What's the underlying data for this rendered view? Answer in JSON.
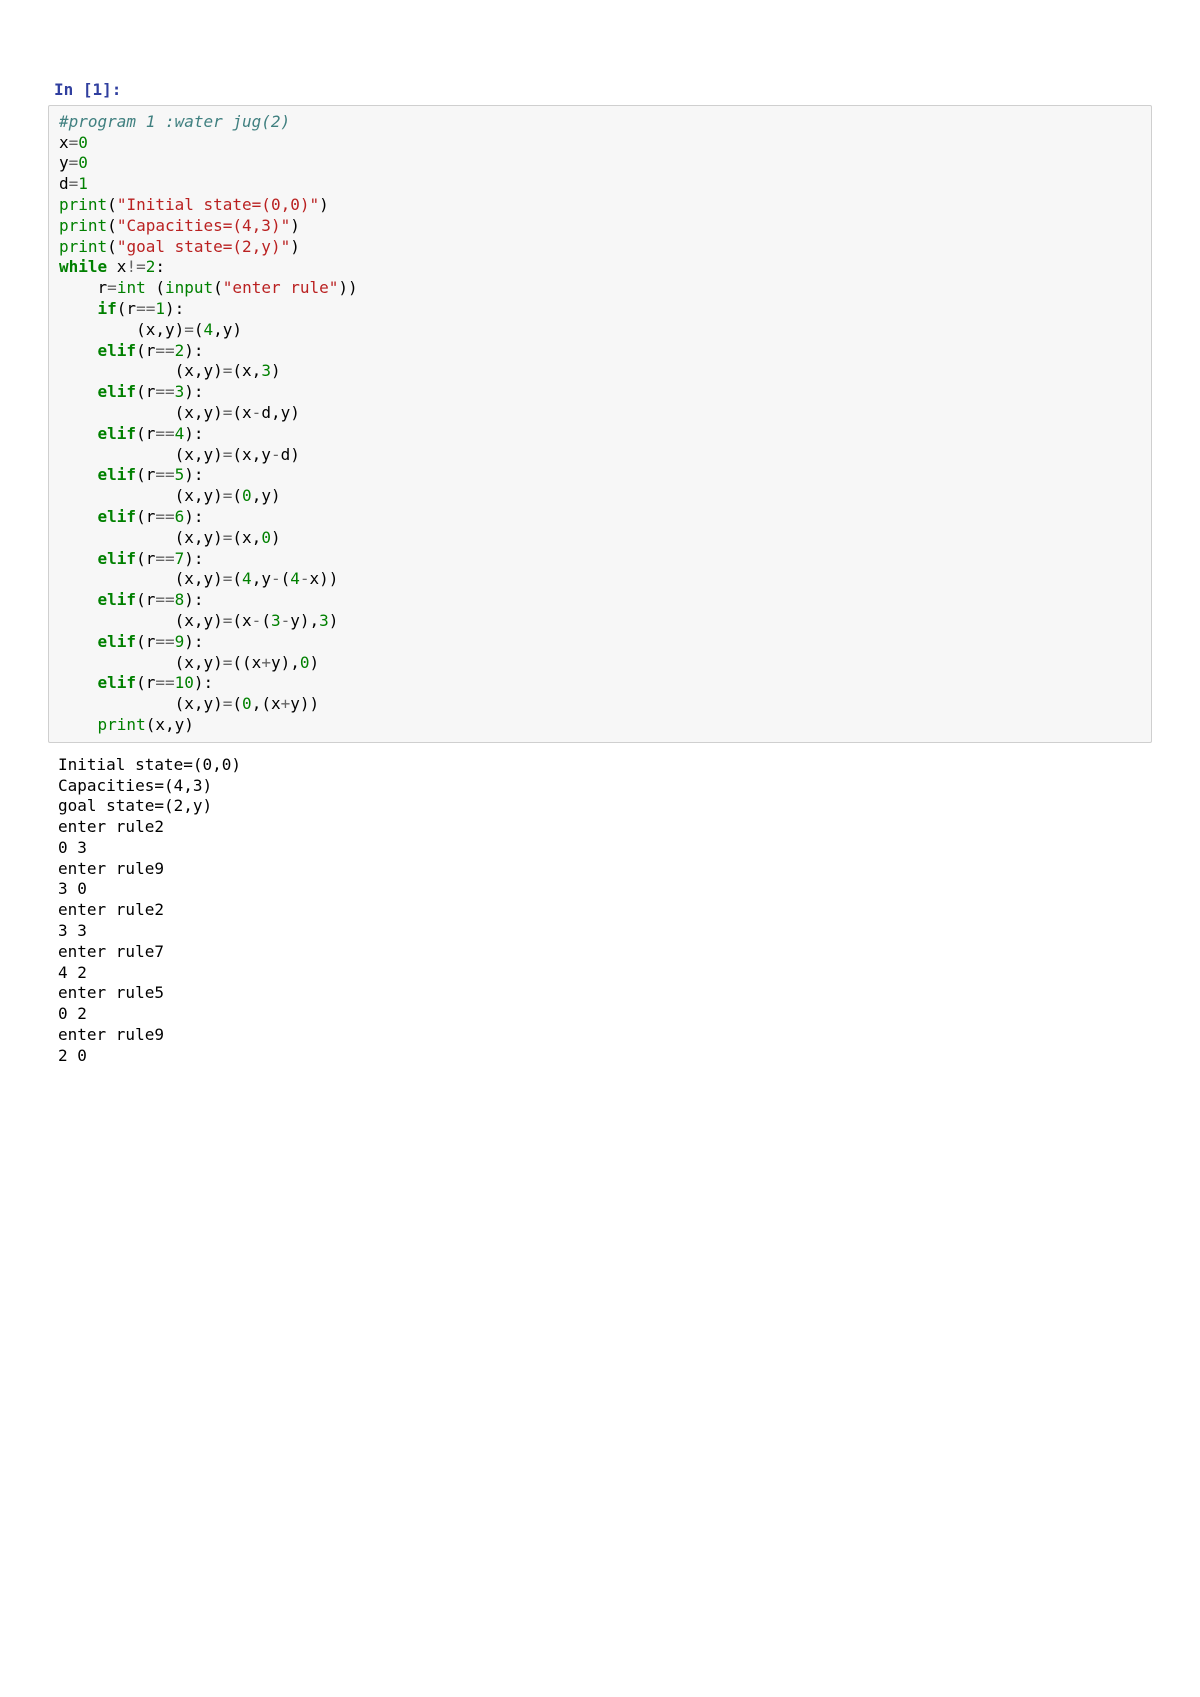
{
  "prompt": "In [1]:",
  "code": {
    "l01_comment": "#program 1 :water jug(2)",
    "l02_x": "x",
    "l02_eq": "=",
    "l02_0": "0",
    "l03_y": "y",
    "l03_eq": "=",
    "l03_0": "0",
    "l04_d": "d",
    "l04_eq": "=",
    "l04_1": "1",
    "l05_print": "print",
    "l05_open": "(",
    "l05_str": "\"Initial state=(0,0)\"",
    "l05_close": ")",
    "l06_print": "print",
    "l06_open": "(",
    "l06_str": "\"Capacities=(4,3)\"",
    "l06_close": ")",
    "l07_print": "print",
    "l07_open": "(",
    "l07_str": "\"goal state=(2,y)\"",
    "l07_close": ")",
    "l08_while": "while",
    "l08_sp": " x",
    "l08_ne": "!=",
    "l08_2": "2",
    "l08_colon": ":",
    "l09_ind": "    r",
    "l09_eq": "=",
    "l09_int": "int",
    "l09_sp": " (",
    "l09_input": "input",
    "l09_open": "(",
    "l09_str": "\"enter rule\"",
    "l09_close": "))",
    "l10_ind": "    ",
    "l10_if": "if",
    "l10_open": "(r",
    "l10_eqeq": "==",
    "l10_1": "1",
    "l10_close": "):",
    "l11_ind": "        (x,y)",
    "l11_eq": "=",
    "l11_open": "(",
    "l11_4": "4",
    "l11_comma": ",y)",
    "l12_ind": "    ",
    "l12_elif": "elif",
    "l12_open": "(r",
    "l12_eqeq": "==",
    "l12_2": "2",
    "l12_close": "):",
    "l13_ind": "            (x,y)",
    "l13_eq": "=",
    "l13_open": "(x,",
    "l13_3": "3",
    "l13_close": ")",
    "l14_ind": "    ",
    "l14_elif": "elif",
    "l14_open": "(r",
    "l14_eqeq": "==",
    "l14_3": "3",
    "l14_close": "):",
    "l15_ind": "            (x,y)",
    "l15_eq": "=",
    "l15_open": "(x",
    "l15_minus": "-",
    "l15_rest": "d,y)",
    "l16_ind": "    ",
    "l16_elif": "elif",
    "l16_open": "(r",
    "l16_eqeq": "==",
    "l16_4": "4",
    "l16_close": "):",
    "l17_ind": "            (x,y)",
    "l17_eq": "=",
    "l17_open": "(x,y",
    "l17_minus": "-",
    "l17_rest": "d)",
    "l18_ind": "    ",
    "l18_elif": "elif",
    "l18_open": "(r",
    "l18_eqeq": "==",
    "l18_5": "5",
    "l18_close": "):",
    "l19_ind": "            (x,y)",
    "l19_eq": "=",
    "l19_open": "(",
    "l19_0": "0",
    "l19_rest": ",y)",
    "l20_ind": "    ",
    "l20_elif": "elif",
    "l20_open": "(r",
    "l20_eqeq": "==",
    "l20_6": "6",
    "l20_close": "):",
    "l21_ind": "            (x,y)",
    "l21_eq": "=",
    "l21_open": "(x,",
    "l21_0": "0",
    "l21_close": ")",
    "l22_ind": "    ",
    "l22_elif": "elif",
    "l22_open": "(r",
    "l22_eqeq": "==",
    "l22_7": "7",
    "l22_close": "):",
    "l23_ind": "            (x,y)",
    "l23_eq": "=",
    "l23_open": "(",
    "l23_4a": "4",
    "l23_mid": ",y",
    "l23_minus1": "-",
    "l23_open2": "(",
    "l23_4b": "4",
    "l23_minus2": "-",
    "l23_rest": "x))",
    "l24_ind": "    ",
    "l24_elif": "elif",
    "l24_open": "(r",
    "l24_eqeq": "==",
    "l24_8": "8",
    "l24_close": "):",
    "l25_ind": "            (x,y)",
    "l25_eq": "=",
    "l25_open": "(x",
    "l25_minus1": "-",
    "l25_open2": "(",
    "l25_3a": "3",
    "l25_minus2": "-",
    "l25_mid": "y),",
    "l25_3b": "3",
    "l25_close": ")",
    "l26_ind": "    ",
    "l26_elif": "elif",
    "l26_open": "(r",
    "l26_eqeq": "==",
    "l26_9": "9",
    "l26_close": "):",
    "l27_ind": "            (x,y)",
    "l27_eq": "=",
    "l27_open": "((x",
    "l27_plus": "+",
    "l27_mid": "y),",
    "l27_0": "0",
    "l27_close": ")",
    "l28_ind": "    ",
    "l28_elif": "elif",
    "l28_open": "(r",
    "l28_eqeq": "==",
    "l28_10": "10",
    "l28_close": "):",
    "l29_ind": "            (x,y)",
    "l29_eq": "=",
    "l29_open": "(",
    "l29_0": "0",
    "l29_mid": ",(x",
    "l29_plus": "+",
    "l29_rest": "y))",
    "l30_ind": "    ",
    "l30_print": "print",
    "l30_args": "(x,y)"
  },
  "output": "Initial state=(0,0)\nCapacities=(4,3)\ngoal state=(2,y)\nenter rule2\n0 3\nenter rule9\n3 0\nenter rule2\n3 3\nenter rule7\n4 2\nenter rule5\n0 2\nenter rule9\n2 0"
}
